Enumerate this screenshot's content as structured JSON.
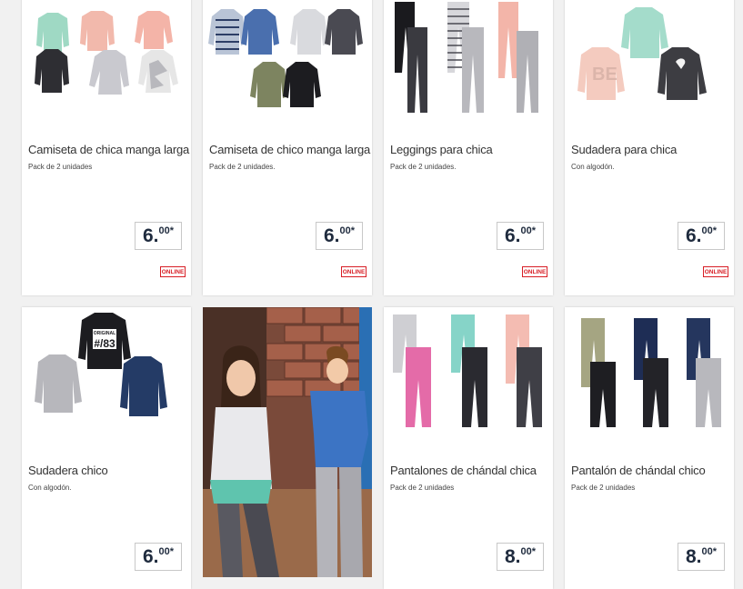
{
  "products": [
    {
      "title": "Camiseta de chica manga larga",
      "subtitle": "Pack de 2 unidades",
      "price_main": "6.",
      "price_cents": "00*",
      "badge": "ONLINE"
    },
    {
      "title": "Camiseta de chico manga larga",
      "subtitle": "Pack de 2 unidades.",
      "price_main": "6.",
      "price_cents": "00*",
      "badge": "ONLINE"
    },
    {
      "title": "Leggings para chica",
      "subtitle": "Pack de 2 unidades.",
      "price_main": "6.",
      "price_cents": "00*",
      "badge": "ONLINE"
    },
    {
      "title": "Sudadera para chica",
      "subtitle": "Con algodón.",
      "price_main": "6.",
      "price_cents": "00*",
      "badge": "ONLINE"
    },
    {
      "title": "Sudadera chico",
      "subtitle": "Con algodón.",
      "price_main": "6.",
      "price_cents": "00*"
    },
    {
      "title": "Pantalones de chándal chica",
      "subtitle": "Pack de 2 unidades",
      "price_main": "8.",
      "price_cents": "00*"
    },
    {
      "title": "Pantalón de chándal chico",
      "subtitle": "Pack de 2 unidades",
      "price_main": "8.",
      "price_cents": "00*"
    }
  ],
  "sweatshirt_print": {
    "line1": "ORIGINAL",
    "line2": "#/83"
  },
  "colors": {
    "online_badge": "#d81e25",
    "price_text": "#1f2b3e"
  }
}
